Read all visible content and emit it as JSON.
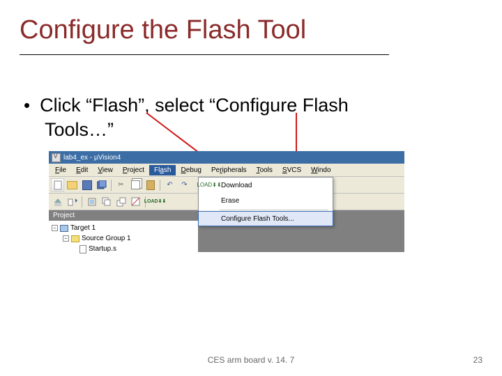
{
  "title": "Configure the Flash Tool",
  "bullet_line1": "Click “Flash”, select “Configure Flash",
  "bullet_line2": "Tools…”",
  "footer_center": "CES arm board v. 14. 7",
  "page_number": "23",
  "window": {
    "title": "lab4_ex  - µVision4"
  },
  "menubar": {
    "items": [
      {
        "label": "File",
        "underline_index": 0
      },
      {
        "label": "Edit",
        "underline_index": 0
      },
      {
        "label": "View",
        "underline_index": 0
      },
      {
        "label": "Project",
        "underline_index": 0
      },
      {
        "label": "Flash",
        "underline_index": 2
      },
      {
        "label": "Debug",
        "underline_index": 0
      },
      {
        "label": "Peripherals",
        "underline_index": 4
      },
      {
        "label": "Tools",
        "underline_index": 0
      },
      {
        "label": "SVCS",
        "underline_index": 0
      },
      {
        "label": "Window",
        "underline_index": 0
      }
    ]
  },
  "flash_menu": {
    "download": "Download",
    "erase": "Erase",
    "configure": "Configure Flash Tools...",
    "load_label": "LOAD"
  },
  "project_panel": {
    "header": "Project",
    "target": "Target 1",
    "group": "Source Group 1",
    "file": "Startup.s"
  }
}
